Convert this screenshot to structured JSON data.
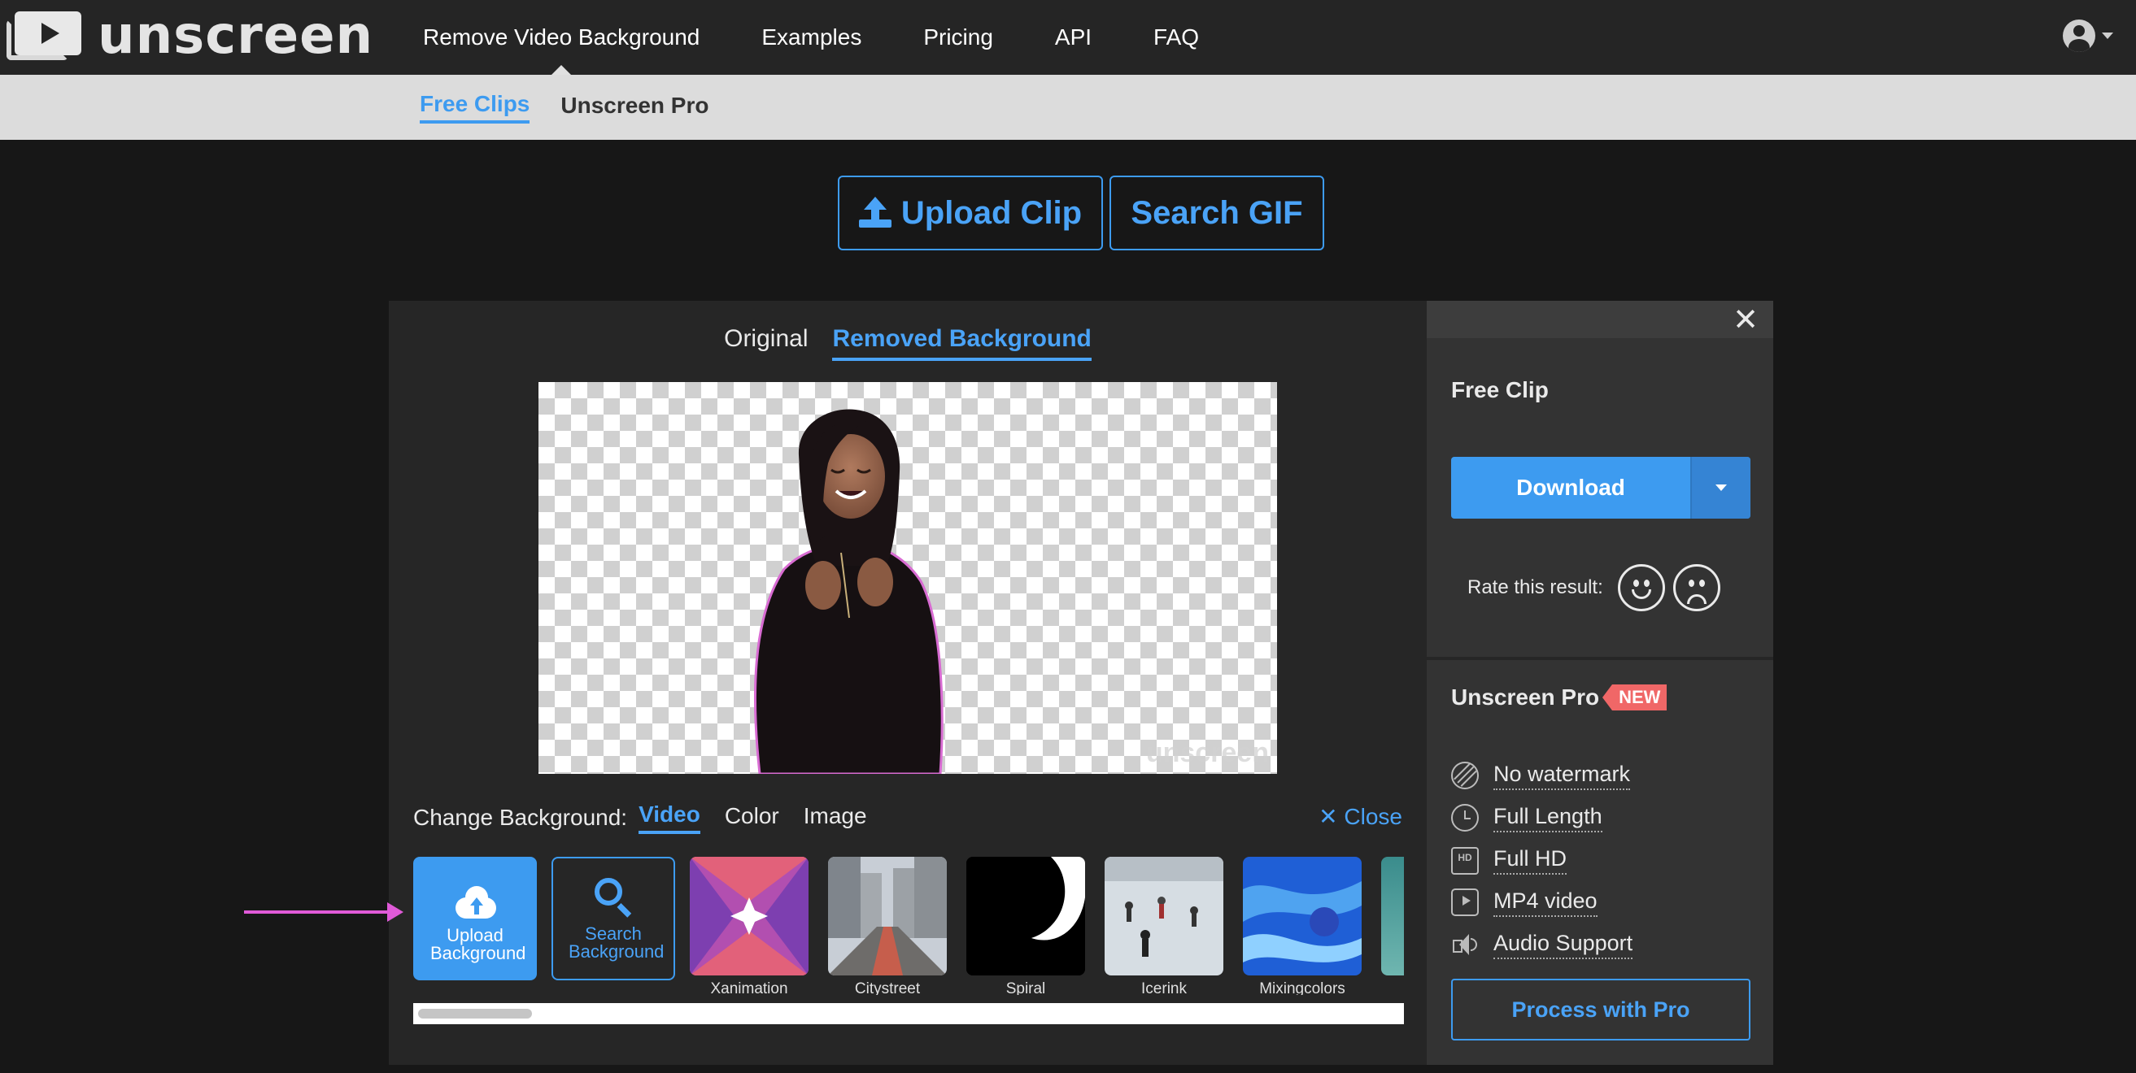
{
  "app": {
    "name": "unscreen"
  },
  "nav": {
    "items": [
      "Remove Video Background",
      "Examples",
      "Pricing",
      "API",
      "FAQ"
    ]
  },
  "subnav": {
    "items": [
      "Free Clips",
      "Unscreen Pro"
    ]
  },
  "actions": {
    "upload_clip": "Upload Clip",
    "search_gif": "Search GIF"
  },
  "view_tabs": [
    "Original",
    "Removed Background"
  ],
  "preview": {
    "watermark": "unscreen"
  },
  "change_background": {
    "label": "Change Background:",
    "tabs": [
      "Video",
      "Color",
      "Image"
    ],
    "close": "Close",
    "upload_label": "Upload Background",
    "search_label": "Search Background",
    "thumbnails": [
      "Xanimation",
      "Citystreet",
      "Spiral",
      "Icerink",
      "Mixingcolors"
    ]
  },
  "side": {
    "close_glyph": "✕",
    "title": "Free Clip",
    "download": "Download",
    "rate_label": "Rate this result:",
    "pro_title": "Unscreen Pro",
    "pro_badge": "NEW",
    "features": [
      "No watermark",
      "Full Length",
      "Full HD",
      "MP4 video",
      "Audio Support"
    ],
    "feature_icons": [
      "no-watermark-icon",
      "clock-icon",
      "hd-icon",
      "mp4-video-icon",
      "audio-icon"
    ],
    "pro_button": "Process with Pro"
  },
  "colors": {
    "accent": "#3d9bf0",
    "topbar": "#252525",
    "subnav": "#dcdcdc",
    "badge": "#f06767",
    "annotation": "#e05ad8"
  }
}
